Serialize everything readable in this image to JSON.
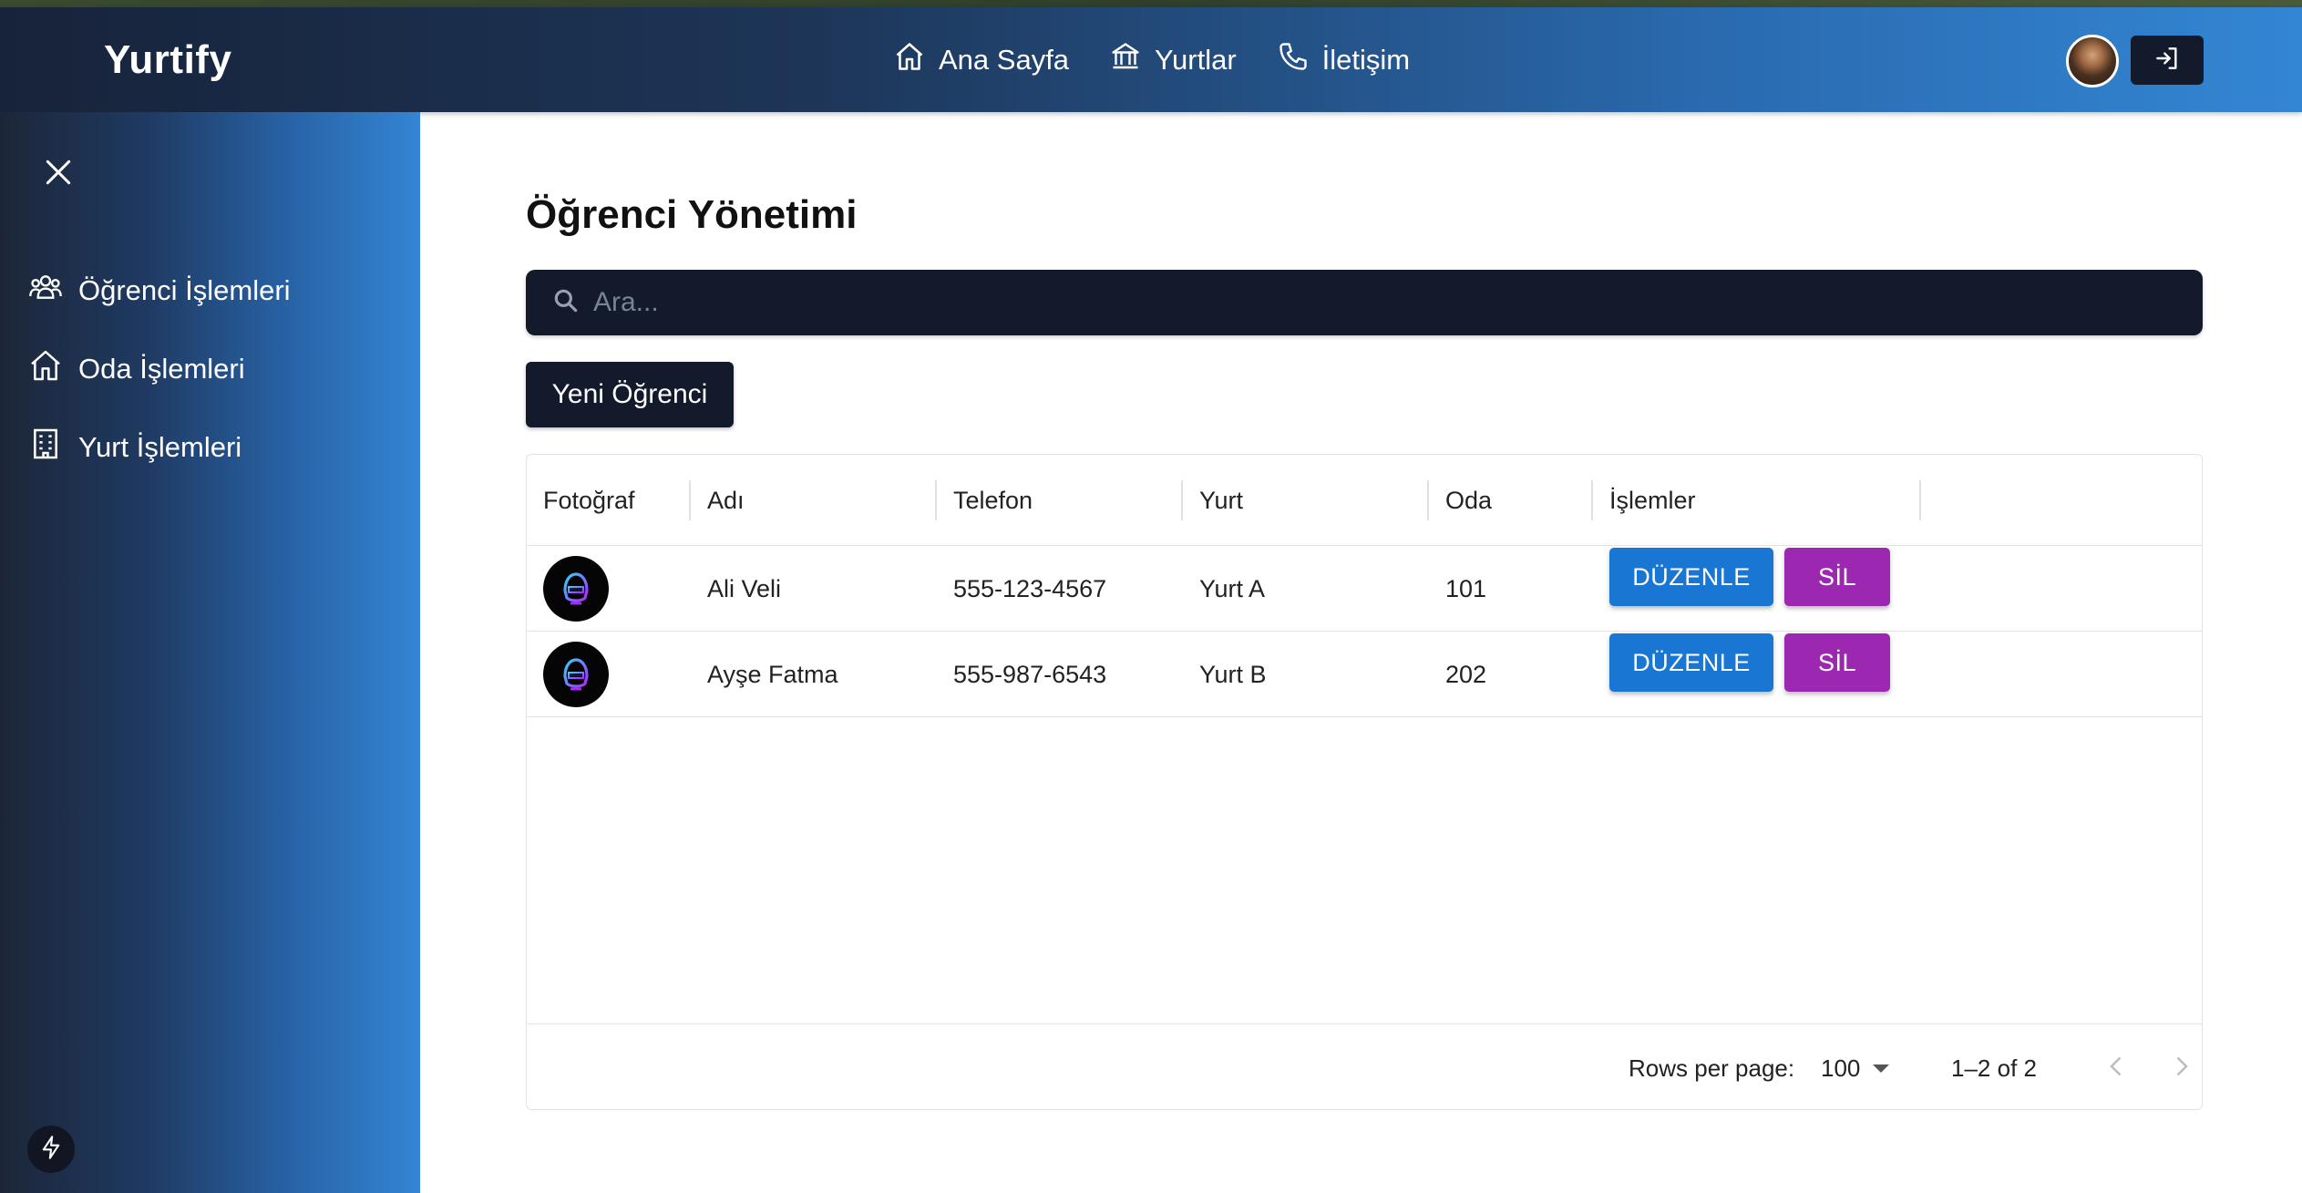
{
  "header": {
    "brand": "Yurtify",
    "nav": [
      {
        "label": "Ana Sayfa",
        "icon": "home-icon"
      },
      {
        "label": "Yurtlar",
        "icon": "bank-icon"
      },
      {
        "label": "İletişim",
        "icon": "phone-icon"
      }
    ],
    "logout_icon": "logout-icon"
  },
  "sidebar": {
    "items": [
      {
        "label": "Öğrenci İşlemleri",
        "icon": "users-icon"
      },
      {
        "label": "Oda İşlemleri",
        "icon": "home-icon"
      },
      {
        "label": "Yurt İşlemleri",
        "icon": "building-icon"
      }
    ]
  },
  "main": {
    "title": "Öğrenci Yönetimi",
    "search_placeholder": "Ara...",
    "new_button": "Yeni Öğrenci",
    "table": {
      "columns": [
        "Fotoğraf",
        "Adı",
        "Telefon",
        "Yurt",
        "Oda",
        "İşlemler"
      ],
      "rows": [
        {
          "name": "Ali Veli",
          "phone": "555-123-4567",
          "dorm": "Yurt A",
          "room": "101"
        },
        {
          "name": "Ayşe Fatma",
          "phone": "555-987-6543",
          "dorm": "Yurt B",
          "room": "202"
        }
      ],
      "edit_label": "DÜZENLE",
      "delete_label": "SİL"
    },
    "pagination": {
      "rows_per_page_label": "Rows per page:",
      "rows_per_page": "100",
      "range": "1–2 of 2"
    }
  },
  "colors": {
    "edit": "#1976d2",
    "delete": "#9c27b0",
    "dark": "#121a2c"
  }
}
